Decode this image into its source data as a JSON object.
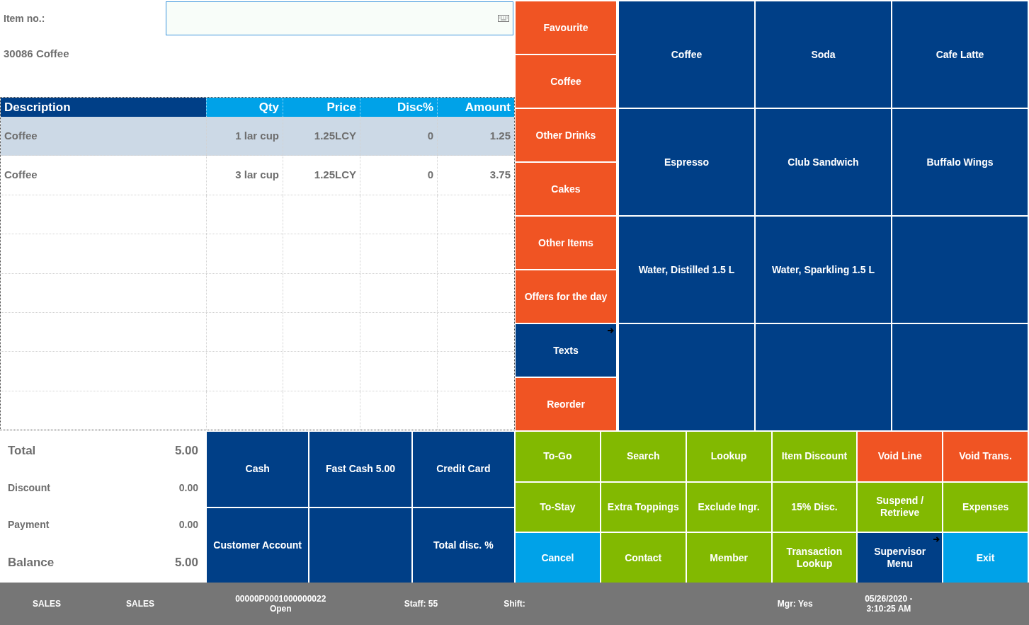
{
  "item_entry": {
    "label": "Item no.:"
  },
  "item_info": "30086 Coffee",
  "table": {
    "columns": [
      {
        "label": "Description",
        "selected": true
      },
      {
        "label": "Qty",
        "selected": false
      },
      {
        "label": "Price",
        "selected": false
      },
      {
        "label": "Disc%",
        "selected": false
      },
      {
        "label": "Amount",
        "selected": false
      }
    ],
    "rows": [
      {
        "cells": [
          "Coffee",
          "1 lar cup",
          "1.25LCY",
          "0",
          "1.25"
        ],
        "selected": true
      },
      {
        "cells": [
          "Coffee",
          "3 lar cup",
          "1.25LCY",
          "0",
          "3.75"
        ],
        "selected": false
      }
    ]
  },
  "totals": [
    {
      "kind": "major",
      "label": "Total",
      "value": "5.00"
    },
    {
      "kind": "minor",
      "label": "Discount",
      "value": "0.00"
    },
    {
      "kind": "minor",
      "label": "Payment",
      "value": "0.00"
    },
    {
      "kind": "major",
      "label": "Balance",
      "value": "5.00"
    }
  ],
  "payment_buttons": [
    {
      "kind": "button",
      "label": "Cash"
    },
    {
      "kind": "button",
      "label": "Fast Cash 5.00"
    },
    {
      "kind": "button",
      "label": "Credit Card"
    },
    {
      "kind": "button",
      "label": "Customer Account"
    },
    {
      "kind": "blank"
    },
    {
      "kind": "button",
      "label": "Total disc. %"
    }
  ],
  "categories": [
    {
      "label": "Favourite",
      "color": "#f05423",
      "submenu": false
    },
    {
      "label": "Coffee",
      "color": "#f05423",
      "submenu": false
    },
    {
      "label": "Other Drinks",
      "color": "#f05423",
      "submenu": false
    },
    {
      "label": "Cakes",
      "color": "#f05423",
      "submenu": false
    },
    {
      "label": "Other Items",
      "color": "#f05423",
      "submenu": false
    },
    {
      "label": "Offers for the day",
      "color": "#f05423",
      "submenu": false
    },
    {
      "label": "Texts",
      "color": "#003f87",
      "submenu": true
    },
    {
      "label": "Reorder",
      "color": "#f05423",
      "submenu": false
    }
  ],
  "items": [
    {
      "kind": "button",
      "label": "Coffee"
    },
    {
      "kind": "button",
      "label": "Soda"
    },
    {
      "kind": "button",
      "label": "Cafe Latte"
    },
    {
      "kind": "button",
      "label": "Espresso"
    },
    {
      "kind": "button",
      "label": "Club Sandwich"
    },
    {
      "kind": "button",
      "label": "Buffalo Wings"
    },
    {
      "kind": "button",
      "label": "Water, Distilled 1.5 L"
    },
    {
      "kind": "button",
      "label": "Water, Sparkling 1.5 L"
    },
    {
      "kind": "blank"
    },
    {
      "kind": "blank"
    },
    {
      "kind": "blank"
    },
    {
      "kind": "blank"
    }
  ],
  "functions": [
    {
      "label": "To-Go",
      "color": "#82b901",
      "submenu": false
    },
    {
      "label": "Search",
      "color": "#82b901",
      "submenu": false
    },
    {
      "label": "Lookup",
      "color": "#82b901",
      "submenu": false
    },
    {
      "label": "Item Discount",
      "color": "#82b901",
      "submenu": false
    },
    {
      "label": "Void Line",
      "color": "#f05423",
      "submenu": false
    },
    {
      "label": "Void Trans.",
      "color": "#f05423",
      "submenu": false
    },
    {
      "label": "To-Stay",
      "color": "#82b901",
      "submenu": false
    },
    {
      "label": "Extra Toppings",
      "color": "#82b901",
      "submenu": false
    },
    {
      "label": "Exclude Ingr.",
      "color": "#82b901",
      "submenu": false
    },
    {
      "label": "15% Disc.",
      "color": "#82b901",
      "submenu": false
    },
    {
      "label": "Suspend / Retrieve",
      "color": "#82b901",
      "submenu": false
    },
    {
      "label": "Expenses",
      "color": "#82b901",
      "submenu": false
    },
    {
      "label": "Cancel",
      "color": "#00a2e8",
      "submenu": false
    },
    {
      "label": "Contact",
      "color": "#82b901",
      "submenu": false
    },
    {
      "label": "Member",
      "color": "#82b901",
      "submenu": false
    },
    {
      "label": "Transaction Lookup",
      "color": "#82b901",
      "submenu": false
    },
    {
      "label": "Supervisor Menu",
      "color": "#003f87",
      "submenu": true
    },
    {
      "label": "Exit",
      "color": "#00a2e8",
      "submenu": false
    }
  ],
  "status_bar": {
    "fields": [
      {
        "lines": [
          "SALES"
        ]
      },
      {
        "lines": [
          "SALES"
        ]
      },
      {
        "lines": [
          "00000P0001000000022",
          "Open"
        ]
      },
      {
        "lines": [
          "Staff: 55"
        ]
      },
      {
        "lines": [
          "Shift:"
        ]
      },
      {
        "lines": [
          "Mgr: Yes"
        ]
      },
      {
        "lines": [
          "05/26/2020 -",
          "3:10:25 AM"
        ]
      }
    ]
  }
}
